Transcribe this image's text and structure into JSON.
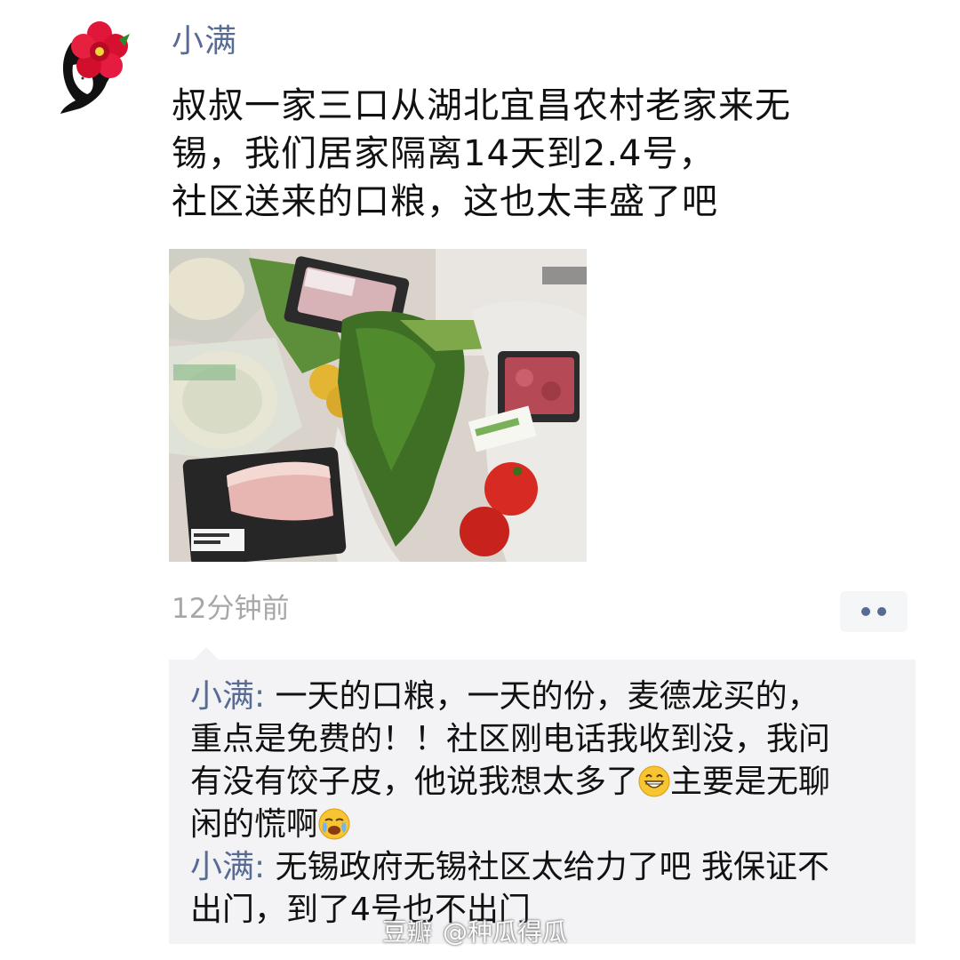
{
  "post": {
    "author": "小满",
    "text_lines": [
      "叔叔一家三口从湖北宜昌农村老家来无",
      "锡，我们居家隔离14天到2.4号，",
      "社区送来的口粮，这也太丰盛了吧"
    ],
    "time": "12分钟前",
    "photo_icon": "groceries-photo"
  },
  "comments": [
    {
      "author": "小满",
      "separator": ":",
      "lines": [
        "一天的口粮，一天的份，麦德龙买的，",
        "重点是免费的！！社区刚电话我收到没，我问",
        "有没有饺子皮，他说我想太多了",
        "主要是无聊",
        "闲的慌啊"
      ]
    },
    {
      "author": "小满",
      "separator": ":",
      "lines": [
        "无锡政府无锡社区太给力了吧 我保证不",
        "出门，到了4号也不出门"
      ]
    }
  ],
  "watermark": {
    "site": "豆瓣",
    "handle": "@种瓜得瓜"
  },
  "colors": {
    "name_blue": "#576b95",
    "time_gray": "#a7a7a7",
    "comment_bg": "#f3f3f5"
  }
}
